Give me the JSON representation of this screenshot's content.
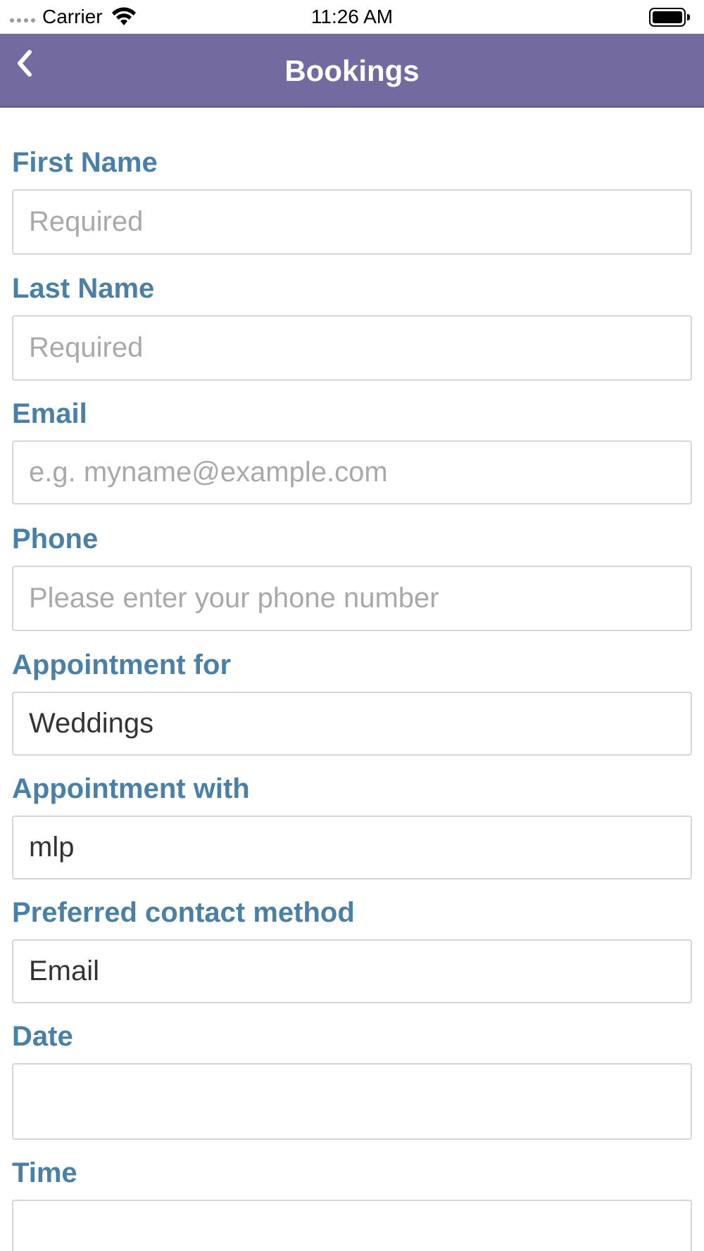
{
  "status_bar": {
    "carrier": "Carrier",
    "time": "11:26 AM"
  },
  "nav": {
    "title": "Bookings",
    "back_icon": "chevron-left-icon",
    "bar_color": "#736a9f"
  },
  "form": {
    "label_color": "#4a7fa6",
    "fields": [
      {
        "label": "First Name",
        "placeholder": "Required",
        "value": ""
      },
      {
        "label": "Last Name",
        "placeholder": "Required",
        "value": ""
      },
      {
        "label": "Email",
        "placeholder": "e.g. myname@example.com",
        "value": ""
      },
      {
        "label": "Phone",
        "placeholder": "Please enter your phone number",
        "value": ""
      },
      {
        "label": "Appointment for",
        "placeholder": "",
        "value": "Weddings"
      },
      {
        "label": "Appointment with",
        "placeholder": "",
        "value": "mlp"
      },
      {
        "label": "Preferred contact method",
        "placeholder": "",
        "value": "Email"
      },
      {
        "label": "Date",
        "placeholder": "",
        "value": ""
      },
      {
        "label": "Time",
        "placeholder": "",
        "value": ""
      }
    ]
  }
}
